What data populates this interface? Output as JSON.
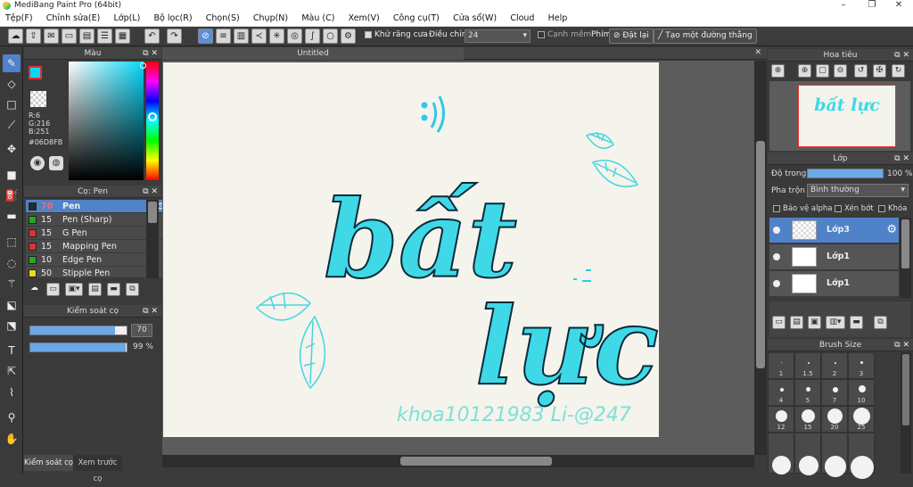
{
  "window": {
    "title": "MediBang Paint Pro (64bit)",
    "min": "–",
    "max": "❐",
    "close": "✕"
  },
  "menu": [
    "Tệp(F)",
    "Chỉnh sửa(E)",
    "Lớp(L)",
    "Bộ lọc(R)",
    "Chọn(S)",
    "Chụp(N)",
    "Màu (C)",
    "Xem(V)",
    "Công cụ(T)",
    "Cửa sổ(W)",
    "Cloud",
    "Help"
  ],
  "toolbar": {
    "antialias_label": "Khử răng cưa",
    "adjust_label": "Điều chỉnh",
    "adjust_value": "24",
    "smooth_label": "Cạnh mềm",
    "key_label": "Phím",
    "reset_label": "Đặt lại",
    "straight_label": "Tạo một đường thẳng"
  },
  "color_panel": {
    "title": "Màu",
    "r": "R:6",
    "g": "G:216",
    "b": "B:251",
    "hex": "#06D8FB",
    "fg": "#06D8FB",
    "bg": "#ffffff"
  },
  "brush_panel": {
    "title": "Cọ: Pen",
    "items": [
      {
        "size": "70",
        "name": "Pen",
        "color": "#2a2a2a"
      },
      {
        "size": "15",
        "name": "Pen (Sharp)",
        "color": "#22aa22"
      },
      {
        "size": "15",
        "name": "G Pen",
        "color": "#e03030"
      },
      {
        "size": "15",
        "name": "Mapping Pen",
        "color": "#e03030"
      },
      {
        "size": "10",
        "name": "Edge Pen",
        "color": "#22aa22"
      },
      {
        "size": "50",
        "name": "Stipple Pen",
        "color": "#e8d820"
      }
    ]
  },
  "brush_control": {
    "title": "Kiểm soát cọ",
    "size": "70",
    "size_fraction": 0.88,
    "opacity": "99 %",
    "opacity_fraction": 0.99
  },
  "bottom_tabs": {
    "brush_control": "Kiểm soát cọ",
    "preview": "Xem trước cọ"
  },
  "canvas": {
    "tab": "Untitled",
    "text_top": "bất",
    "text_bottom": "lực",
    "signature": "khoa10121983   Li-@247"
  },
  "navigator": {
    "title": "Hoa tiêu",
    "preview_text": "bất lực"
  },
  "layer_panel": {
    "title": "Lớp",
    "opacity_label": "Độ trong",
    "opacity_value": "100 %",
    "opacity_fraction": 1.0,
    "blend_label": "Pha trộn",
    "blend_value": "Bình thường",
    "protect_alpha": "Bảo vệ alpha",
    "clip": "Xén bớt",
    "lock": "Khóa",
    "layers": [
      {
        "name": "Lớp3"
      },
      {
        "name": "Lớp1"
      },
      {
        "name": "Lớp1"
      }
    ]
  },
  "brush_size": {
    "title": "Brush Size",
    "sizes": [
      "1",
      "1.5",
      "2",
      "3",
      "4",
      "5",
      "7",
      "10",
      "12",
      "15",
      "20",
      "25"
    ]
  },
  "colors": {
    "accent": "#4f82c9",
    "canvas_text": "#3fd8e6"
  }
}
